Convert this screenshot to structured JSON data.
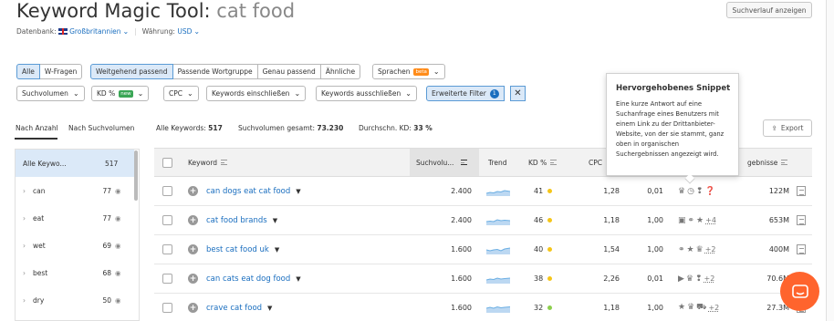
{
  "header": {
    "title": "Keyword Magic Tool:",
    "keyword": "cat food",
    "history_button": "Suchverlauf anzeigen",
    "database_label": "Datenbank:",
    "database_value": "Großbritannien",
    "currency_label": "Währung:",
    "currency_value": "USD"
  },
  "filters": {
    "match_group_1": [
      "Alle",
      "W-Fragen"
    ],
    "match_group_2": [
      "Weitgehend passend",
      "Passende Wortgruppe",
      "Genau passend",
      "Ähnliche"
    ],
    "languages": {
      "label": "Sprachen",
      "badge": "beta"
    },
    "row2": {
      "volume": "Suchvolumen",
      "kd": "KD %",
      "kd_badge": "new",
      "cpc": "CPC",
      "include": "Keywords einschließen",
      "exclude": "Keywords ausschließen",
      "advanced": "Erweiterte Filter",
      "advanced_count": "1"
    }
  },
  "tabs": [
    "Nach Anzahl",
    "Nach Suchvolumen"
  ],
  "stats": {
    "all_keywords_label": "Alle Keywords:",
    "all_keywords_value": "517",
    "volume_label": "Suchvolumen gesamt:",
    "volume_value": "73.230",
    "kd_label": "Durchschn. KD:",
    "kd_value": "33 %"
  },
  "export_label": "Export",
  "sidebar": {
    "all": {
      "label": "Alle Keywo...",
      "count": "517"
    },
    "items": [
      {
        "label": "can",
        "count": "77"
      },
      {
        "label": "eat",
        "count": "77"
      },
      {
        "label": "wet",
        "count": "69"
      },
      {
        "label": "best",
        "count": "68"
      },
      {
        "label": "dry",
        "count": "50"
      }
    ]
  },
  "table": {
    "headers": {
      "keyword": "Keyword",
      "volume": "Suchvolu...",
      "trend": "Trend",
      "kd": "KD %",
      "cpc": "CPC",
      "results": "gebnisse"
    },
    "rows": [
      {
        "keyword": "can dogs eat cat food",
        "volume": "2.400",
        "kd": "41",
        "kd_color": "#f5c518",
        "cpc": "1,28",
        "com": "0,01",
        "features": "♛◷❢❓",
        "more": "",
        "results": "122M"
      },
      {
        "keyword": "cat food brands",
        "volume": "2.400",
        "kd": "46",
        "kd_color": "#f5c518",
        "cpc": "1,18",
        "com": "1,00",
        "features": "▣⚭★",
        "more": "+4",
        "results": "653M"
      },
      {
        "keyword": "best cat food uk",
        "volume": "1.600",
        "kd": "40",
        "kd_color": "#f5c518",
        "cpc": "1,54",
        "com": "1,00",
        "features": "⚭★♛",
        "more": "+2",
        "results": "400M"
      },
      {
        "keyword": "can cats eat dog food",
        "volume": "1.600",
        "kd": "38",
        "kd_color": "#f5c518",
        "cpc": "2,26",
        "com": "0,01",
        "features": "▶♛❢",
        "more": "+2",
        "results": "70.6M"
      },
      {
        "keyword": "crave cat food",
        "volume": "1.600",
        "kd": "32",
        "kd_color": "#8ccf4d",
        "cpc": "1,18",
        "com": "1,00",
        "features": "★♛⛟",
        "more": "+2",
        "results": "27.3M"
      }
    ]
  },
  "tooltip": {
    "title": "Hervorgehobenes Snippet",
    "body": "Eine kurze Antwort auf eine Suchanfrage eines Benutzers mit einem Link zu der Drittanbieter-Website, von der sie stammt, ganz oben in organischen Suchergebnissen angezeigt wird."
  }
}
